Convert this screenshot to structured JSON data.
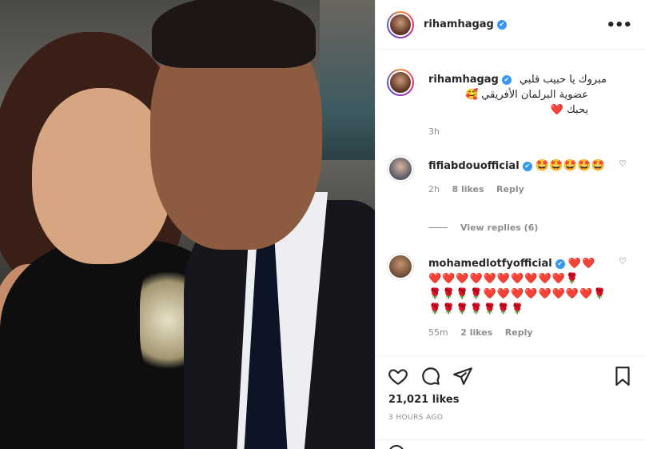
{
  "post": {
    "username": "rihamhagag",
    "verified_mark": "✔",
    "more_icon": "more-horizontal-icon"
  },
  "caption": {
    "username": "rihamhagag",
    "line1": "مبروك يا حبيب قلبي",
    "line2": "عضوية البرلمان الأفريقي 🥰",
    "line3": "بحبك ❤️",
    "time": "3h"
  },
  "comments": [
    {
      "username": "fifiabdouofficial",
      "text": "🤩🤩🤩🤩🤩",
      "time": "2h",
      "likes": "8 likes",
      "reply": "Reply",
      "view_replies": "View replies (6)"
    },
    {
      "username": "mohamedlotfyofficial",
      "text_line1": "❤️❤️",
      "text_line2": "❤️❤️❤️❤️❤️❤️❤️❤️❤️❤️🌹",
      "text_line3": "🌹🌹🌹🌹❤️❤️❤️❤️❤️❤️❤️❤️🌹",
      "text_line4": "🌹🌹🌹🌹🌹🌹🌹",
      "time": "55m",
      "likes": "2 likes",
      "reply": "Reply"
    }
  ],
  "footer": {
    "likes": "21,021 likes",
    "timestamp": "3 HOURS AGO"
  },
  "colors": {
    "verified": "#3897f0",
    "text": "#262626",
    "muted": "#8e8e8e",
    "heart": "#ed4956"
  }
}
